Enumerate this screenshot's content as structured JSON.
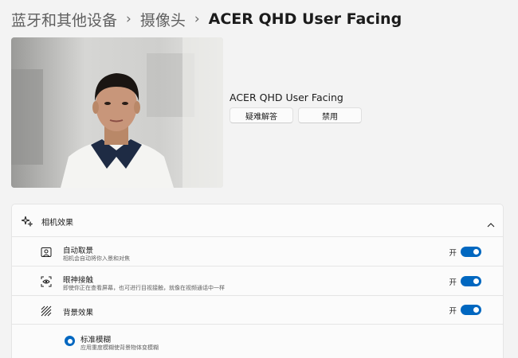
{
  "breadcrumb": {
    "level1": "蓝牙和其他设备",
    "level2": "摄像头",
    "current": "ACER QHD User Facing",
    "separator": "›"
  },
  "device": {
    "name": "ACER QHD User Facing",
    "troubleshoot_label": "疑难解答",
    "disable_label": "禁用"
  },
  "effects": {
    "title": "相机效果",
    "items": [
      {
        "title": "自动取景",
        "subtitle": "相机会自动将你入景和对焦",
        "state": "开",
        "icon": "frame-person-icon",
        "on": true
      },
      {
        "title": "眼神接触",
        "subtitle": "即使你正在查看屏幕，也可进行目视接触，就像在视频通话中一样",
        "state": "开",
        "icon": "eye-contact-icon",
        "on": true
      },
      {
        "title": "背景效果",
        "state": "开",
        "icon": "background-effects-icon",
        "on": true
      }
    ],
    "blur_option": {
      "title": "标准模糊",
      "subtitle": "应用重度模糊使背景物体变模糊",
      "selected": true
    }
  },
  "colors": {
    "accent": "#0067c0",
    "background": "#f3f3f3",
    "card": "#fbfbfb"
  }
}
